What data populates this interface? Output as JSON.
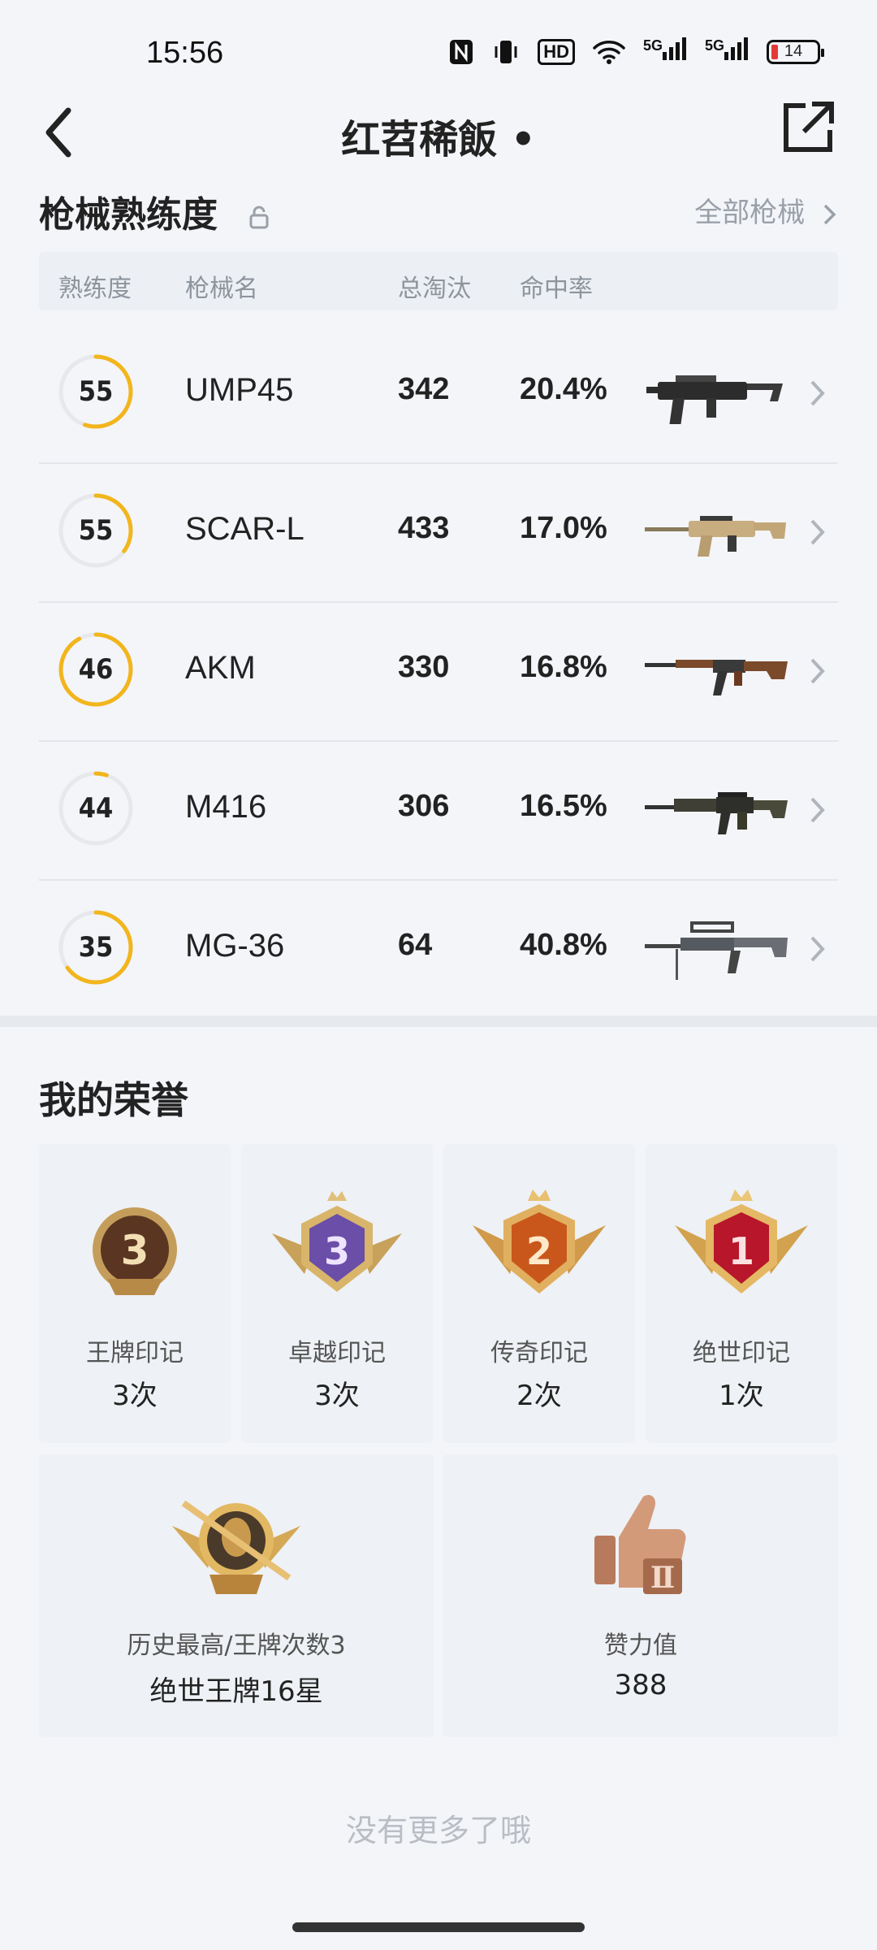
{
  "status": {
    "time": "15:56",
    "icons": [
      "nfc-icon",
      "vibrate-icon",
      "hd-icon",
      "wifi-icon",
      "signal-5g-icon",
      "signal-5g-icon"
    ],
    "hd_label": "HD",
    "net1": "5G",
    "net2": "5G",
    "battery": "14"
  },
  "header": {
    "title": "红苕稀飯 •"
  },
  "weapons": {
    "section_title": "枪械熟练度",
    "all_link": "全部枪械",
    "columns": [
      "熟练度",
      "枪械名",
      "总淘汰",
      "命中率"
    ],
    "rows": [
      {
        "level": "55",
        "name": "UMP45",
        "kills": "342",
        "hit_rate": "20.4%",
        "progress": 0.55,
        "icon": "ump45-gun-image"
      },
      {
        "level": "55",
        "name": "SCAR-L",
        "kills": "433",
        "hit_rate": "17.0%",
        "progress": 0.35,
        "icon": "scar-l-gun-image"
      },
      {
        "level": "46",
        "name": "AKM",
        "kills": "330",
        "hit_rate": "16.8%",
        "progress": 0.92,
        "icon": "akm-gun-image"
      },
      {
        "level": "44",
        "name": "M416",
        "kills": "306",
        "hit_rate": "16.5%",
        "progress": 0.05,
        "icon": "m416-gun-image"
      },
      {
        "level": "35",
        "name": "MG-36",
        "kills": "64",
        "hit_rate": "40.8%",
        "progress": 0.65,
        "icon": "mg36-gun-image"
      }
    ]
  },
  "honors": {
    "section_title": "我的荣誉",
    "marks": [
      {
        "label": "王牌印记",
        "value": "3次",
        "numeral": "3",
        "icon": "ace-mark-badge"
      },
      {
        "label": "卓越印记",
        "value": "3次",
        "numeral": "3",
        "icon": "excellence-mark-badge"
      },
      {
        "label": "传奇印记",
        "value": "2次",
        "numeral": "2",
        "icon": "legend-mark-badge"
      },
      {
        "label": "绝世印记",
        "value": "1次",
        "numeral": "1",
        "icon": "peerless-mark-badge"
      }
    ],
    "best": {
      "label": "历史最高/王牌次数3",
      "value": "绝世王牌16星",
      "icon": "highest-rank-badge"
    },
    "likes": {
      "label": "赞力值",
      "value": "388",
      "icon": "thumbs-up-badge",
      "numeral": "Ⅱ"
    }
  },
  "footer": {
    "no_more": "没有更多了哦"
  },
  "colors": {
    "accent_ring": "#f2b51c",
    "ring_track": "#e6e8ec",
    "background": "#f3f5f9"
  }
}
